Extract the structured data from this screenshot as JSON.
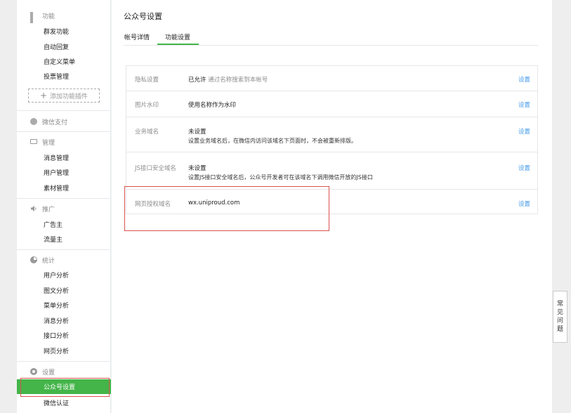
{
  "sidebar": {
    "groups": {
      "features": {
        "label": "功能",
        "items": [
          "群发功能",
          "自动回复",
          "自定义菜单",
          "投票管理"
        ],
        "add_plugin": "添加功能插件"
      },
      "payment": {
        "label": "微信支付"
      },
      "manage": {
        "label": "管理",
        "items": [
          "消息管理",
          "用户管理",
          "素材管理"
        ]
      },
      "promote": {
        "label": "推广",
        "items": [
          "广告主",
          "流量主"
        ]
      },
      "stats": {
        "label": "统计",
        "items": [
          "用户分析",
          "图文分析",
          "菜单分析",
          "消息分析",
          "接口分析",
          "网页分析"
        ]
      },
      "settings": {
        "label": "设置",
        "items": [
          "公众号设置",
          "微信认证"
        ]
      }
    },
    "active_item": "公众号设置",
    "accent_color": "#44b549"
  },
  "main": {
    "title": "公众号设置",
    "tabs": [
      {
        "label": "帐号详情"
      },
      {
        "label": "功能设置",
        "active": true
      }
    ],
    "rows": [
      {
        "label": "隐私设置",
        "value": "已允许",
        "note": "通过名称搜索到本帐号",
        "action": "设置"
      },
      {
        "label": "图片水印",
        "value": "使用名称作为水印",
        "action": "设置"
      },
      {
        "label": "业务域名",
        "value": "未设置",
        "desc": "设置业务域名后，在微信内访问该域名下页面时，不会被重新排版。",
        "action": "设置"
      },
      {
        "label": "JS接口安全域名",
        "value": "未设置",
        "desc": "设置JS接口安全域名后，公众号开发者可在该域名下调用微信开放的JS接口",
        "action": "设置"
      },
      {
        "label": "网页授权域名",
        "value": "wx.uniproud.com",
        "action": "设置"
      }
    ]
  },
  "faq": {
    "chars": [
      "常",
      "见",
      "问",
      "题"
    ]
  },
  "colors": {
    "link": "#459ae9",
    "highlight": "#d9534f"
  }
}
